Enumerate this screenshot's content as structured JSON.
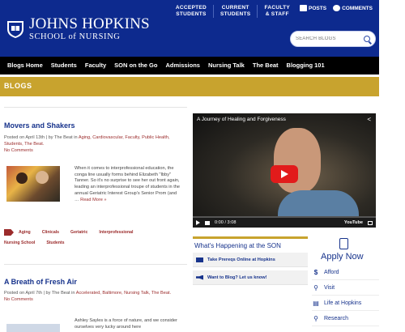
{
  "header": {
    "logo_line1": "JOHNS HOPKINS",
    "logo_line2": "SCHOOL of NURSING",
    "top_links": [
      {
        "line1": "ACCEPTED",
        "line2": "STUDENTS"
      },
      {
        "line1": "CURRENT",
        "line2": "STUDENTS"
      },
      {
        "line1": "FACULTY",
        "line2": "& STAFF"
      }
    ],
    "posts_label": "POSTS",
    "comments_label": "COMMENTS",
    "search_placeholder": "SEARCH BLOGS"
  },
  "nav": {
    "items": [
      "Blogs Home",
      "Students",
      "Faculty",
      "SON on the Go",
      "Admissions",
      "Nursing Talk",
      "The Beat",
      "Blogging 101"
    ]
  },
  "banner": {
    "title": "BLOGS"
  },
  "posts": [
    {
      "title": "Movers and Shakers",
      "meta_prefix": "Posted on April 13th | by The Beat in ",
      "categories": "Aging, Cardiovascular, Faculty, Public Health, Students, The Beat.",
      "comments": "No Comments",
      "excerpt": "When it comes to interprofessional education, the conga line usually forms behind Elizabeth \"Ibby\" Tanner. So it's no surprise to see her out front again, leading an interprofessional troupe of students in the annual Geriatric Interest Group's Senior Prom (and …",
      "read_more": "Read More »",
      "tags": [
        "Aging",
        "Clinicals",
        "Geriatric",
        "Interprofessional",
        "Nursing School",
        "Students"
      ]
    },
    {
      "title": "A Breath of Fresh Air",
      "meta_prefix": "Posted on April 7th | by The Beat in ",
      "categories": "Accelerated, Baltimore, Nursing Talk, The Beat.",
      "comments": "No Comments",
      "excerpt": "Ashley Sayles is a force of nature, and we consider ourselves very lucky around here"
    }
  ],
  "video": {
    "title": "A Journey of Healing and Forgiveness",
    "time": "0:00 / 3:08",
    "brand": "YouTube",
    "progress": 0.0
  },
  "whats_happening": {
    "title": "What's Happening at the SON",
    "items": [
      {
        "icon": "laptop-icon",
        "label": "Take Prereqs Online at Hopkins"
      },
      {
        "icon": "megaphone-icon",
        "label": "Want to Blog? Let us know!"
      }
    ]
  },
  "sidebar": {
    "apply_now": "Apply Now",
    "links": [
      {
        "icon": "dollar-icon",
        "glyph": "$",
        "label": "Afford"
      },
      {
        "icon": "location-pin-icon",
        "glyph": "⚲",
        "label": "Visit"
      },
      {
        "icon": "book-icon",
        "glyph": "▤",
        "label": "Life at Hopkins"
      },
      {
        "icon": "magnifier-icon",
        "glyph": "⚲",
        "label": "Research"
      }
    ]
  },
  "colors": {
    "header_blue": "#0d2a8e",
    "gold": "#c8a32e",
    "link_red": "#9b2b2b",
    "title_blue": "#17338c"
  }
}
